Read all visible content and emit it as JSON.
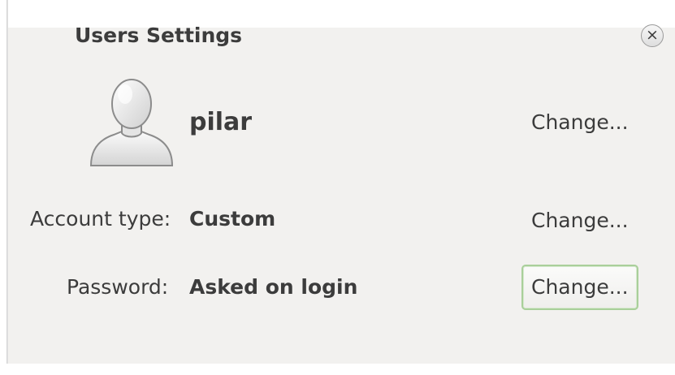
{
  "window": {
    "title": "Users Settings",
    "close_glyph": "×"
  },
  "user": {
    "name": "pilar",
    "avatar_icon": "user-silhouette-icon",
    "change_label": "Change..."
  },
  "rows": [
    {
      "label": "Account type:",
      "value": "Custom",
      "change_label": "Change..."
    },
    {
      "label": "Password:",
      "value": "Asked on login",
      "change_label": "Change..."
    }
  ],
  "colors": {
    "window_bg": "#f2f1ef",
    "text": "#3c3c3c",
    "focus_border": "#a9cf9a"
  }
}
